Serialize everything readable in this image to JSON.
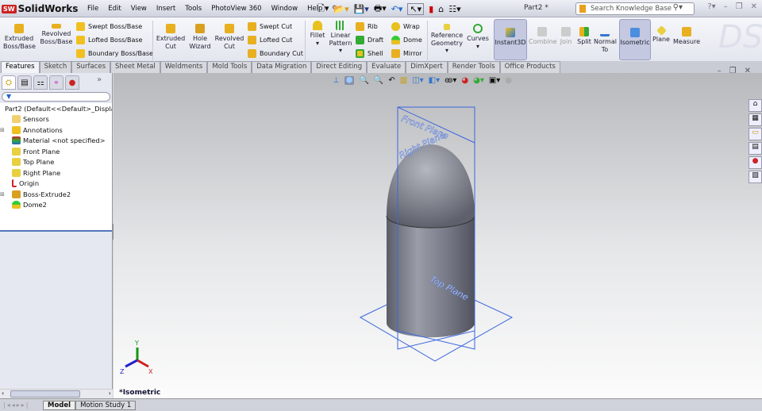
{
  "app": {
    "name": "SolidWorks",
    "badge": "SW",
    "doc_title": "Part2 *"
  },
  "menu": [
    "File",
    "Edit",
    "View",
    "Insert",
    "Tools",
    "PhotoView 360",
    "Window",
    "Help"
  ],
  "search": {
    "placeholder": "Search Knowledge Base"
  },
  "commands": {
    "extruded_boss": "Extruded Boss/Base",
    "revolved_boss": "Revolved Boss/Base",
    "swept_boss": "Swept Boss/Base",
    "lofted_boss": "Lofted Boss/Base",
    "boundary_boss": "Boundary Boss/Base",
    "extruded_cut": "Extruded Cut",
    "hole_wizard": "Hole Wizard",
    "revolved_cut": "Revolved Cut",
    "swept_cut": "Swept Cut",
    "lofted_cut": "Lofted Cut",
    "boundary_cut": "Boundary Cut",
    "fillet": "Fillet",
    "linear_pattern": "Linear Pattern",
    "rib": "Rib",
    "draft": "Draft",
    "shell": "Shell",
    "wrap": "Wrap",
    "dome": "Dome",
    "mirror": "Mirror",
    "reference_geometry": "Reference Geometry",
    "curves": "Curves",
    "instant3d": "Instant3D",
    "combine": "Combine",
    "join": "Join",
    "split": "Split",
    "normal_to": "Normal To",
    "isometric": "Isometric",
    "plane": "Plane",
    "measure": "Measure"
  },
  "tabs": [
    "Features",
    "Sketch",
    "Surfaces",
    "Sheet Metal",
    "Weldments",
    "Mold Tools",
    "Data Migration",
    "Direct Editing",
    "Evaluate",
    "DimXpert",
    "Render Tools",
    "Office Products"
  ],
  "tree": {
    "root": "Part2  (Default<<Default>_Displa",
    "items": [
      "Sensors",
      "Annotations",
      "Material <not specified>",
      "Front Plane",
      "Top Plane",
      "Right Plane",
      "Origin",
      "Boss-Extrude2",
      "Dome2"
    ]
  },
  "viewport": {
    "view_name": "*Isometric",
    "planes": [
      "Front Plane",
      "Right Plane",
      "Top Plane"
    ],
    "axes": [
      "X",
      "Y",
      "Z"
    ]
  },
  "bottom_tabs": [
    "Model",
    "Motion Study 1"
  ]
}
